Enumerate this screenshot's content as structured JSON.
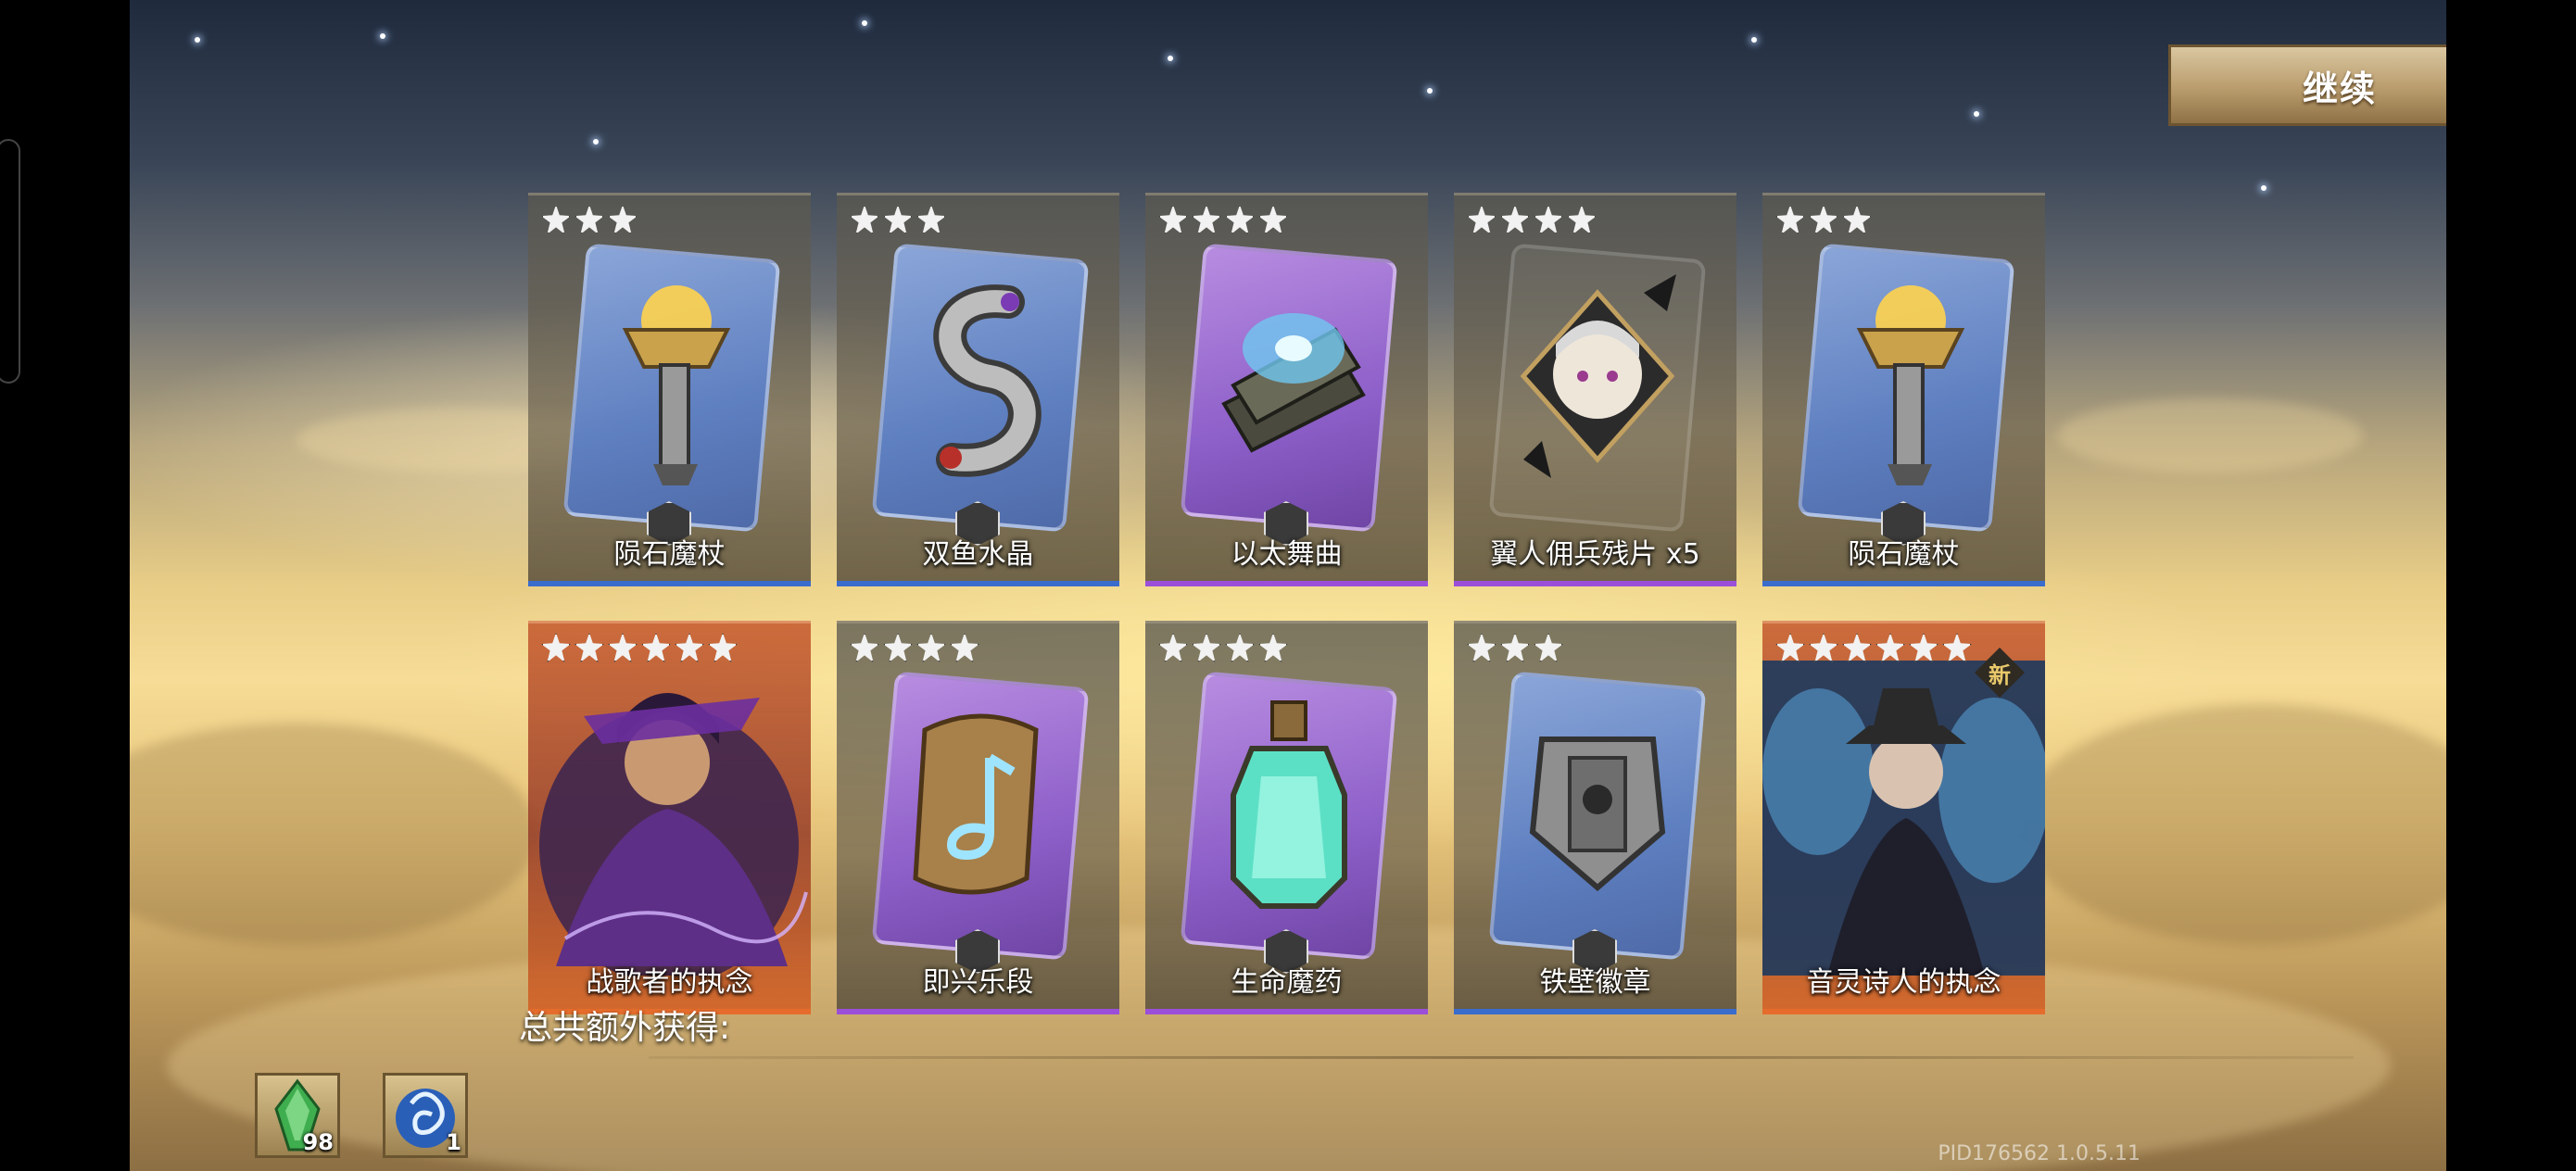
{
  "continue_label": "继续",
  "cards": [
    {
      "name": "陨石魔杖",
      "stars": 3,
      "rarity": "blue",
      "icon": "meteor-staff-icon"
    },
    {
      "name": "双鱼水晶",
      "stars": 3,
      "rarity": "blue",
      "icon": "twin-fish-crystal-icon"
    },
    {
      "name": "以太舞曲",
      "stars": 4,
      "rarity": "purple",
      "icon": "ether-dance-book-icon"
    },
    {
      "name": "翼人佣兵残片 x5",
      "stars": 4,
      "rarity": "purple",
      "icon": "winged-mercenary-shard-icon"
    },
    {
      "name": "陨石魔杖",
      "stars": 3,
      "rarity": "blue",
      "icon": "meteor-staff-icon"
    },
    {
      "name": "战歌者的执念",
      "stars": 6,
      "rarity": "orange",
      "icon": "warsinger-hero-portrait"
    },
    {
      "name": "即兴乐段",
      "stars": 4,
      "rarity": "purple",
      "icon": "improv-scroll-icon"
    },
    {
      "name": "生命魔药",
      "stars": 4,
      "rarity": "purple",
      "icon": "life-potion-icon"
    },
    {
      "name": "铁壁徽章",
      "stars": 3,
      "rarity": "blue",
      "icon": "iron-wall-badge-icon"
    },
    {
      "name": "音灵诗人的执念",
      "stars": 6,
      "rarity": "orange",
      "icon": "sound-spirit-poet-portrait",
      "badge": "新"
    }
  ],
  "total_extra_label": "总共额外获得:",
  "rewards": [
    {
      "icon": "green-crystal-icon",
      "qty": "98"
    },
    {
      "icon": "blue-sigil-icon",
      "qty": "1"
    }
  ],
  "pid": "PID176562  1.0.5.11"
}
